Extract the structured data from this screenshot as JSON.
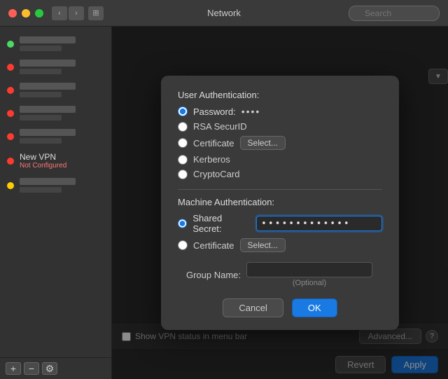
{
  "titleBar": {
    "title": "Network",
    "searchPlaceholder": "Search"
  },
  "sidebar": {
    "items": [
      {
        "id": "item1",
        "status": "green",
        "name": "blurred",
        "sub": "blurred"
      },
      {
        "id": "item2",
        "status": "red",
        "name": "blurred",
        "sub": "blurred"
      },
      {
        "id": "item3",
        "status": "red",
        "name": "blurred",
        "sub": "blurred"
      },
      {
        "id": "item4",
        "status": "red",
        "name": "blurred",
        "sub": "blurred"
      },
      {
        "id": "item5",
        "status": "red",
        "name": "blurred",
        "sub": "blurred"
      }
    ],
    "newVpn": {
      "name": "New VPN",
      "sub": "Not Configured"
    },
    "itemLast": {
      "status": "yellow",
      "name": "blurred",
      "sub": "blurred"
    },
    "addLabel": "+",
    "removeLabel": "−",
    "gearLabel": "⚙"
  },
  "bottomBar": {
    "checkboxLabel": "Show VPN status in menu bar",
    "advancedLabel": "Advanced...",
    "helpLabel": "?"
  },
  "actionBar": {
    "revertLabel": "Revert",
    "applyLabel": "Apply"
  },
  "modal": {
    "userAuthTitle": "User Authentication:",
    "userAuthOptions": [
      {
        "id": "password",
        "label": "Password:",
        "selected": true,
        "hasField": true,
        "fieldValue": "••••"
      },
      {
        "id": "rsa",
        "label": "RSA SecurID",
        "selected": false
      },
      {
        "id": "certificate",
        "label": "Certificate",
        "selected": false,
        "hasSelect": true,
        "selectLabel": "Select..."
      },
      {
        "id": "kerberos",
        "label": "Kerberos",
        "selected": false
      },
      {
        "id": "cryptocard",
        "label": "CryptoCard",
        "selected": false
      }
    ],
    "machineAuthTitle": "Machine Authentication:",
    "machineAuthOptions": [
      {
        "id": "shared",
        "label": "Shared Secret:",
        "selected": true,
        "hasField": true,
        "fieldValue": "•••••••••••••"
      },
      {
        "id": "cert",
        "label": "Certificate",
        "selected": false,
        "hasSelect": true,
        "selectLabel": "Select..."
      }
    ],
    "groupNameLabel": "Group Name:",
    "groupNamePlaceholder": "",
    "groupNameHint": "(Optional)",
    "cancelLabel": "Cancel",
    "okLabel": "OK"
  }
}
